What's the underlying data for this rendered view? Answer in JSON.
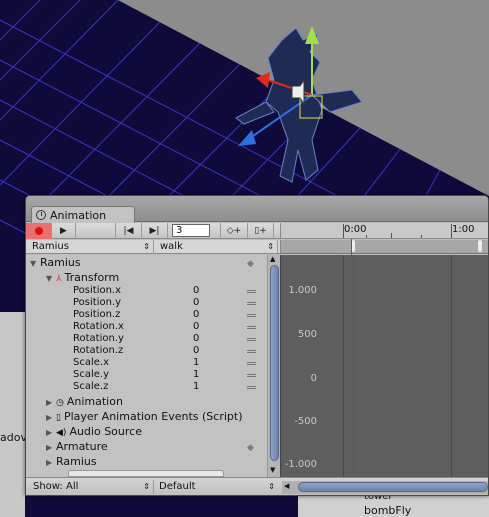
{
  "window": {
    "tab_title": "Animation"
  },
  "toolbar": {
    "record_icon": "record-icon",
    "play_icon": "play-icon",
    "prev_key_icon": "prev-keyframe-icon",
    "next_key_icon": "next-keyframe-icon",
    "frame_value": "3",
    "add_keyframe_icon": "add-keyframe-icon",
    "add_event_icon": "add-event-icon"
  },
  "ruler": {
    "labels": [
      "0:00",
      "1:00"
    ]
  },
  "selectors": {
    "object": "Ramius",
    "clip": "walk"
  },
  "hierarchy": {
    "root": "Ramius",
    "transform": "Transform",
    "properties": [
      {
        "name": "Position.x",
        "value": "0"
      },
      {
        "name": "Position.y",
        "value": "0"
      },
      {
        "name": "Position.z",
        "value": "0"
      },
      {
        "name": "Rotation.x",
        "value": "0"
      },
      {
        "name": "Rotation.y",
        "value": "0"
      },
      {
        "name": "Rotation.z",
        "value": "0"
      },
      {
        "name": "Scale.x",
        "value": "1"
      },
      {
        "name": "Scale.y",
        "value": "1"
      },
      {
        "name": "Scale.z",
        "value": "1"
      }
    ],
    "components": [
      "Animation",
      "Player Animation Events (Script)",
      "Audio Source",
      "Armature",
      "Ramius"
    ]
  },
  "curves": {
    "y_labels": [
      "1.000",
      "500",
      "0",
      "-500",
      "-1.000"
    ]
  },
  "bottom_bar": {
    "show": "Show: All",
    "wrap": "Default"
  },
  "background": {
    "left_fragment": "adov",
    "right_items": [
      "tower",
      "bombFly"
    ]
  },
  "colors": {
    "grid_line": "#3b3bd6",
    "grid_bg": "#0f0a3a",
    "record": "#d81010",
    "playhead": "#e02020",
    "scroll_thumb": "#7f93ba"
  }
}
